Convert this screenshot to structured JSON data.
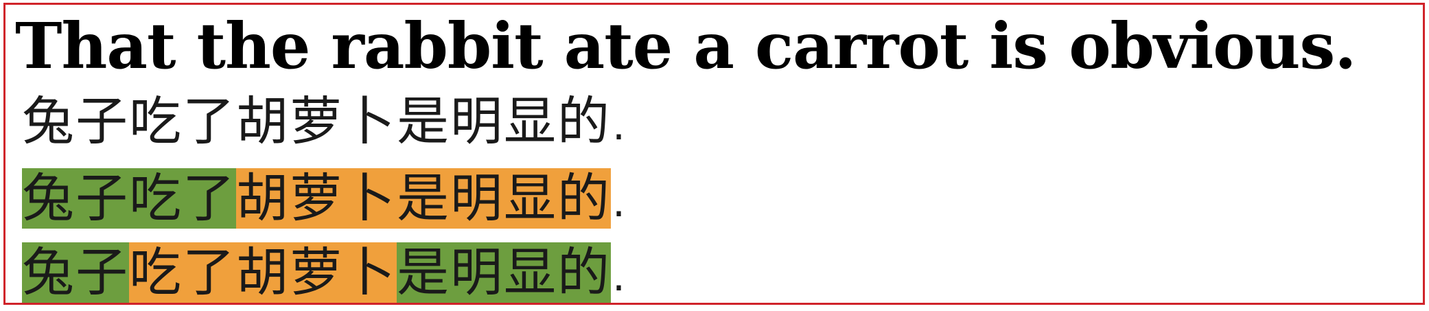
{
  "english_sentence": "That the rabbit ate a carrot is obvious.",
  "colors": {
    "frame_border": "#d0232a",
    "green": "#6d9e3f",
    "orange": "#f0a03c"
  },
  "lines": [
    {
      "segments": [
        {
          "text": "兔子吃了胡萝卜是明显的",
          "color": "none"
        }
      ],
      "trailing": "."
    },
    {
      "segments": [
        {
          "text": "兔子吃了",
          "color": "green"
        },
        {
          "text": "胡萝卜是明显的",
          "color": "orange"
        }
      ],
      "trailing": "."
    },
    {
      "segments": [
        {
          "text": "兔子",
          "color": "green"
        },
        {
          "text": "吃了胡萝卜",
          "color": "orange"
        },
        {
          "text": "是明显的",
          "color": "green"
        }
      ],
      "trailing": "."
    }
  ]
}
